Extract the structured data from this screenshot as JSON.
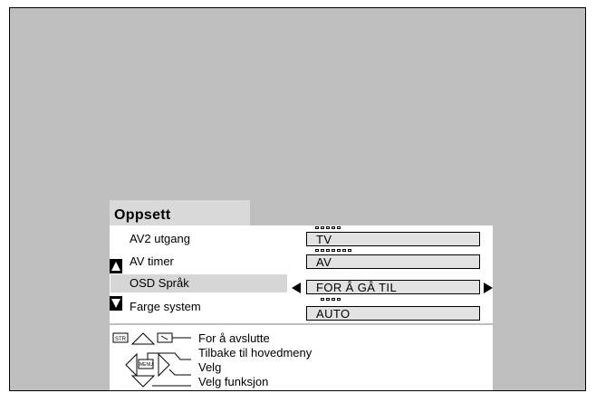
{
  "menu": {
    "title": "Oppsett",
    "items": [
      {
        "label": "AV2 utgang",
        "value": "TV",
        "dots": 5
      },
      {
        "label": "AV timer",
        "value": "AV",
        "dots": 7
      },
      {
        "label": "OSD Språk",
        "value": "FOR Â GÂ TIL",
        "dots": 0,
        "selected": true
      },
      {
        "label": "Farge system",
        "value": "AUTO",
        "dots": 4
      }
    ]
  },
  "legend": {
    "exit": "For å avslutte",
    "back": "Tilbake til hovedmeny",
    "select": "Velg",
    "select_function": "Velg funksjon",
    "str_key": "STR",
    "menu_key": "MENU"
  },
  "colors": {
    "background": "#bebebe",
    "panel": "#ffffff",
    "selected_row": "#d6d6d6",
    "value_box": "#e2e2e2"
  }
}
